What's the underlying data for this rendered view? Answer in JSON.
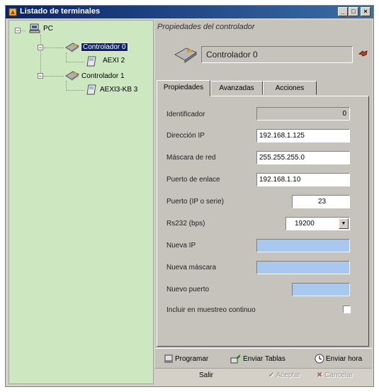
{
  "window": {
    "title": "Listado de terminales"
  },
  "tree": {
    "root": "PC",
    "items": [
      {
        "label": "Controlador 0"
      },
      {
        "label": "AEXI 2"
      },
      {
        "label": "Controlador 1"
      },
      {
        "label": "AEXI3-KB 3"
      }
    ]
  },
  "panel": {
    "title": "Propiedades del controlador",
    "header_name": "Controlador 0"
  },
  "tabs": [
    {
      "label": "Propiedades"
    },
    {
      "label": "Avanzadas"
    },
    {
      "label": "Acciones"
    }
  ],
  "props": {
    "identificador": {
      "label": "Identificador",
      "value": "0"
    },
    "direccion_ip": {
      "label": "Dirección IP",
      "value": "192.168.1.125"
    },
    "mascara": {
      "label": "Máscara de red",
      "value": "255.255.255.0"
    },
    "puerto_enlace": {
      "label": "Puerto de enlace",
      "value": "192.168.1.10"
    },
    "puerto_ip": {
      "label": "Puerto (IP o serie)",
      "value": "23"
    },
    "rs232": {
      "label": "Rs232 (bps)",
      "value": "19200"
    },
    "nueva_ip": {
      "label": "Nueva IP",
      "value": ""
    },
    "nueva_mascara": {
      "label": "Nueva máscara",
      "value": ""
    },
    "nuevo_puerto": {
      "label": "Nuevo puerto",
      "value": ""
    },
    "incluir": {
      "label": "Incluir en muestreo continuo"
    }
  },
  "toolbar": {
    "programar": "Programar",
    "enviar_tablas": "Enviar Tablas",
    "enviar_hora": "Enviar hora"
  },
  "bottom": {
    "salir": "Salir",
    "aceptar": "Aceptar",
    "cancelar": "Cancelar"
  },
  "colors": {
    "tree_bg": "#cde8c0",
    "title_bar": "#0a246a",
    "new_field": "#a9c8ee"
  }
}
